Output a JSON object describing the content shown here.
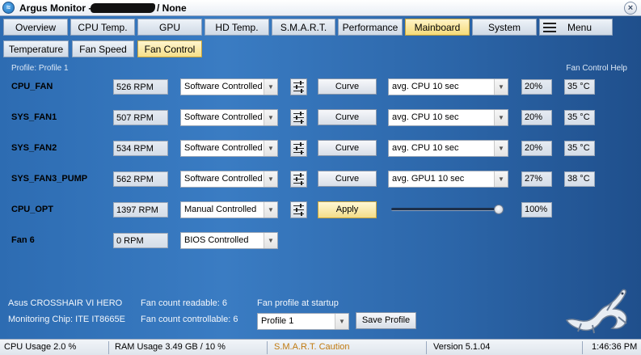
{
  "window": {
    "title": "Argus Monitor - ",
    "title_suffix": "/ None",
    "close_glyph": "×",
    "icon": "argus-logo-icon"
  },
  "main_tabs": [
    {
      "label": "Overview",
      "active": false
    },
    {
      "label": "CPU Temp.",
      "active": false
    },
    {
      "label": "GPU",
      "active": false
    },
    {
      "label": "HD Temp.",
      "active": false
    },
    {
      "label": "S.M.A.R.T.",
      "active": false
    },
    {
      "label": "Performance",
      "active": false
    },
    {
      "label": "Mainboard",
      "active": true
    },
    {
      "label": "System",
      "active": false
    },
    {
      "label": "Menu",
      "active": false
    }
  ],
  "sub_tabs": [
    {
      "label": "Temperature",
      "active": false
    },
    {
      "label": "Fan Speed",
      "active": false
    },
    {
      "label": "Fan Control",
      "active": true
    }
  ],
  "profile_label": "Profile: Profile 1",
  "help_link": "Fan Control Help",
  "fans": [
    {
      "name": "CPU_FAN",
      "rpm": "526 RPM",
      "mode": "Software Controlled",
      "button": "Curve",
      "source": "avg. CPU 10 sec",
      "percent": "20%",
      "temp": "35 °C"
    },
    {
      "name": "SYS_FAN1",
      "rpm": "507 RPM",
      "mode": "Software Controlled",
      "button": "Curve",
      "source": "avg. CPU 10 sec",
      "percent": "20%",
      "temp": "35 °C"
    },
    {
      "name": "SYS_FAN2",
      "rpm": "534 RPM",
      "mode": "Software Controlled",
      "button": "Curve",
      "source": "avg. CPU 10 sec",
      "percent": "20%",
      "temp": "35 °C"
    },
    {
      "name": "SYS_FAN3_PUMP",
      "rpm": "562 RPM",
      "mode": "Software Controlled",
      "button": "Curve",
      "source": "avg. GPU1 10 sec",
      "percent": "27%",
      "temp": "38 °C"
    },
    {
      "name": "CPU_OPT",
      "rpm": "1397 RPM",
      "mode": "Manual Controlled",
      "button": "Apply",
      "percent": "100%",
      "slider_value": 1.0
    },
    {
      "name": "Fan 6",
      "rpm": "0 RPM",
      "mode": "BIOS Controlled"
    }
  ],
  "board": {
    "name": "Asus CROSSHAIR VI HERO",
    "chip": "Monitoring Chip: ITE IT8665E",
    "readable": "Fan count readable: 6",
    "controllable": "Fan count controllable: 6",
    "startup_label": "Fan profile at startup",
    "startup_value": "Profile 1",
    "save_button": "Save Profile"
  },
  "statusbar": {
    "cpu": "CPU Usage 2.0 %",
    "ram": "RAM Usage 3.49 GB / 10 %",
    "smart": "S.M.A.R.T. Caution",
    "version": "Version 5.1.04",
    "time": "1:46:36 PM"
  },
  "colors": {
    "active_tab": "#f5db7a",
    "smart_caution": "#c07a10",
    "panel_blue": "#3a7cc3"
  }
}
